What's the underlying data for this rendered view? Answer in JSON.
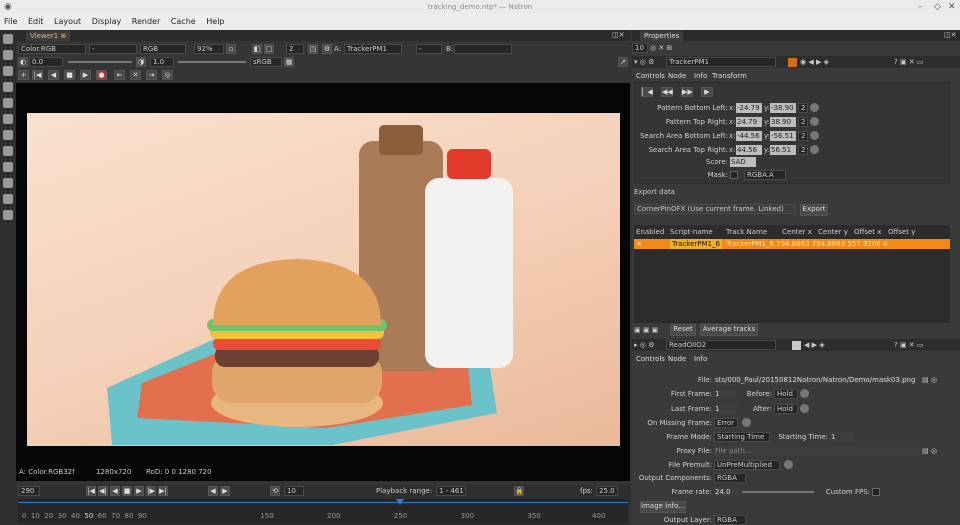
{
  "window": {
    "title": "tracking_demo.ntp* — Natron"
  },
  "menu": [
    "File",
    "Edit",
    "Layout",
    "Display",
    "Render",
    "Cache",
    "Help"
  ],
  "viewer": {
    "tab": "Viewer1",
    "layer": "Color.RGB",
    "channels": "RGB",
    "zoom": "92%",
    "proxy": "2",
    "input_a": "TrackerPM1",
    "input_b_label": "B:",
    "input_a_label": "A:",
    "gain": "0.0",
    "gamma_label": "Y",
    "gamma": "1.0",
    "colorspace": "sRGB",
    "footer_format": "A: Color.RGB32f",
    "footer_res": "1280x720",
    "footer_rod": "RoD: 0 0 1280 720"
  },
  "timeline": {
    "frame": "290",
    "step": "10",
    "playback_label": "Playback range:",
    "playback_range": "1 - 461",
    "fps_label": "fps:",
    "fps": "25.0",
    "ticks": [
      "0",
      "10",
      "20",
      "30",
      "40",
      "50",
      "60",
      "70",
      "80",
      "90",
      "100",
      "150",
      "200",
      "250",
      "300",
      "350",
      "400",
      "450"
    ],
    "ticks_pos_hint": "decorative"
  },
  "properties": {
    "tab": "Properties",
    "count": "10",
    "tracker": {
      "name": "TrackerPM1",
      "tabs": [
        "Controls",
        "Node",
        "Info",
        "Transform"
      ],
      "rows": [
        {
          "label": "Pattern Bottom Left:",
          "x": "-24.79",
          "y": "-38.90",
          "d": "2"
        },
        {
          "label": "Pattern Top Right:",
          "x": "24.79",
          "y": "38.90",
          "d": "2"
        },
        {
          "label": "Search Area Bottom Left:",
          "x": "-44.56",
          "y": "-56.51",
          "d": "2"
        },
        {
          "label": "Search Area Top Right:",
          "x": "44.56",
          "y": "56.51",
          "d": "2"
        }
      ],
      "score_label": "Score:",
      "score": "SAD",
      "mask_label": "Mask:",
      "mask": "RGBA.A",
      "export_label": "Export data",
      "export_mode": "CornerPinOFX (Use current frame. Linked)",
      "export_button": "Export",
      "table_headers": [
        "Enabled",
        "Script-name",
        "Track Name",
        "Center x",
        "Center y",
        "Offset x",
        "Offset y"
      ],
      "table_row": {
        "enabled": "✕",
        "script": "TrackerPM1_6",
        "rest": "TrackerPM1_6 794.8863 794.8863 557.9206 0"
      },
      "reset": "Reset",
      "average": "Average tracks"
    },
    "read": {
      "name": "ReadOIIO2",
      "tabs": [
        "Controls",
        "Node",
        "Info"
      ],
      "file_label": "File:",
      "file": "sts/000_Paul/20150812Natron/Natron/Demo/mask03.png",
      "first_frame_label": "First Frame:",
      "first_frame": "1",
      "before_label": "Before:",
      "before": "Hold",
      "last_frame_label": "Last Frame:",
      "last_frame": "1",
      "after_label": "After:",
      "after": "Hold",
      "missing_label": "On Missing Frame:",
      "missing": "Error",
      "frame_mode_label": "Frame Mode:",
      "frame_mode": "Starting Time",
      "starting_time_label": "Starting Time:",
      "starting_time": "1",
      "proxy_label": "Proxy File:",
      "proxy": "File path...",
      "premult_label": "File Premult:",
      "premult": "UnPreMultiplied",
      "output_comp_label": "Output Components:",
      "output_comp": "RGBA",
      "frame_rate_label": "Frame rate:",
      "frame_rate": "24.0",
      "custom_fps_label": "Custom FPS:",
      "image_info": "Image Info...",
      "output_layer_label": "Output Layer:",
      "output_layer": "RGBA"
    }
  }
}
